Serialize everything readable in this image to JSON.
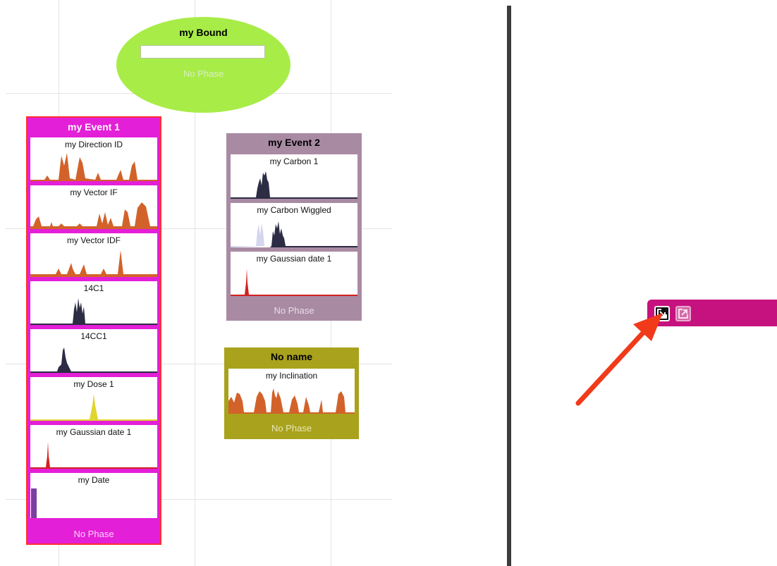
{
  "bound": {
    "title": "my Bound",
    "input_value": "",
    "phase": "No Phase"
  },
  "events": [
    {
      "title": "my Event 1",
      "color": "#e41fd8",
      "selected": true,
      "phase": "No Phase",
      "items": [
        {
          "label": "my Direction ID",
          "graph_color": "#d2622a"
        },
        {
          "label": "my Vector IF",
          "graph_color": "#d2622a"
        },
        {
          "label": "my Vector IDF",
          "graph_color": "#d2622a"
        },
        {
          "label": "14C1",
          "graph_color": "#2c2c44"
        },
        {
          "label": "14CC1",
          "graph_color": "#2c2c44"
        },
        {
          "label": "my Dose 1",
          "graph_color": "#e0d431"
        },
        {
          "label": "my Gaussian date 1",
          "graph_color": "#d12020"
        },
        {
          "label": "my Date",
          "graph_color": "#7b3fa0"
        }
      ]
    },
    {
      "title": "my Event 2",
      "color": "#a98aa3",
      "phase": "No Phase",
      "items": [
        {
          "label": "my Carbon 1",
          "graph_color": "#2c2c44"
        },
        {
          "label": "my Carbon Wiggled",
          "graph_color": "#2c2c44"
        },
        {
          "label": "my Gaussian date 1",
          "graph_color": "#d12020"
        }
      ]
    },
    {
      "title": "No name",
      "color": "#a9a21c",
      "phase": "No Phase",
      "items": [
        {
          "label": "my Inclination",
          "graph_color": "#d2622a"
        }
      ]
    }
  ],
  "toolbar": {
    "color": "#c6127e",
    "buttons": [
      {
        "icon": "import-icon"
      },
      {
        "icon": "export-icon"
      }
    ]
  },
  "annotation": {
    "icon": "red-arrow-icon",
    "color": "#f03a1a"
  }
}
